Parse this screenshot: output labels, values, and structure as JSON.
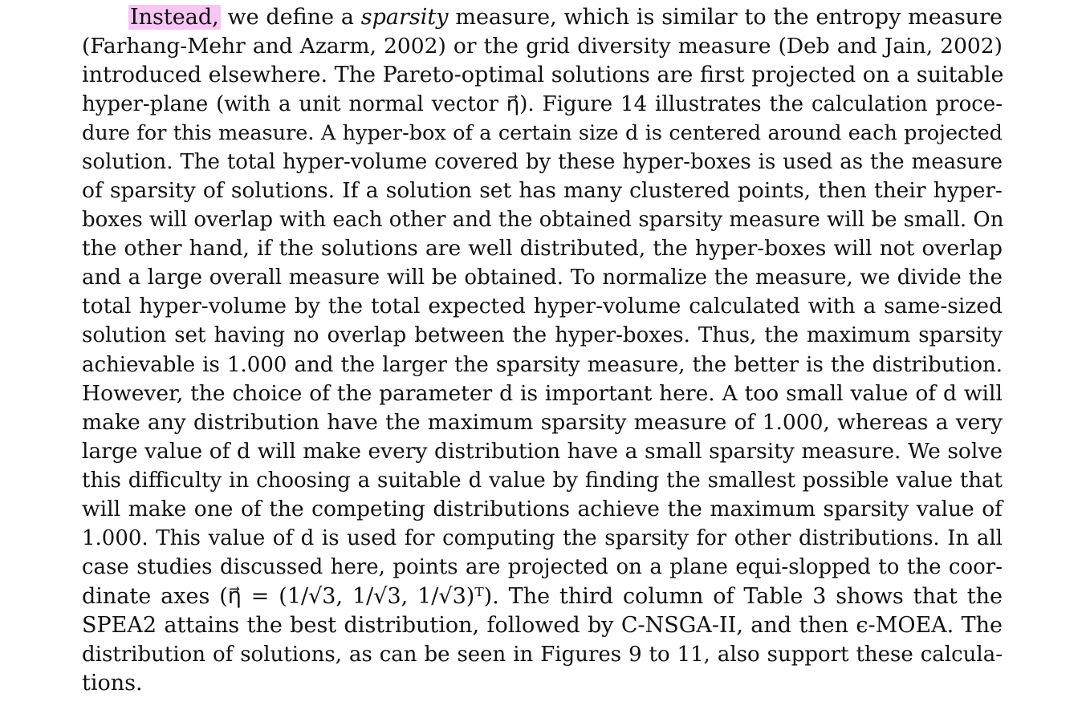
{
  "paragraph": {
    "highlight_word": "Instead,",
    "line0_a": "we define a",
    "line0_italic": "sparsity",
    "line0_b": "measure, which is similar to the entropy measure",
    "lines": [
      "(Farhang-Mehr and Azarm, 2002) or the grid diversity measure (Deb and Jain, 2002)",
      "introduced elsewhere.  The Pareto-optimal solutions are first projected on a suitable",
      "hyper-plane (with a unit normal vector η⃗). Figure 14 illustrates the calculation proce-",
      "dure for this measure. A hyper-box of a certain size d is centered around each projected",
      "solution. The total hyper-volume covered by these hyper-boxes is used as the measure",
      "of sparsity of solutions.  If a solution set has many clustered points, then their hyper-",
      "boxes will overlap with each other and the obtained sparsity measure will be small. On",
      "the other hand, if the solutions are well distributed, the hyper-boxes will not overlap",
      "and a large overall measure will be obtained. To normalize the measure, we divide the",
      "total hyper-volume by the total expected hyper-volume calculated with a same-sized",
      "solution set having no overlap between the hyper-boxes. Thus, the maximum sparsity",
      "achievable is 1.000 and the larger the sparsity measure, the better is the distribution.",
      "However, the choice of the parameter d is important here.  A too small value of d will",
      "make any distribution have the maximum sparsity measure of 1.000, whereas a very",
      "large value of d will make every distribution have a small sparsity measure. We solve",
      "this difficulty in choosing a suitable d value by finding the smallest possible value that",
      "will make one of the competing distributions achieve the maximum sparsity value of",
      "1.000. This value of d is used for computing the sparsity for other distributions. In all",
      "case studies discussed here, points are projected on a plane equi-slopped to the coor-",
      "dinate axes (η⃗ = (1/√3, 1/√3, 1/√3)ᵀ).  The third column of Table 3 shows that the",
      "SPEA2 attains the best distribution, followed by C-NSGA-II, and then ϵ-MOEA.  The",
      "distribution of solutions, as can be seen in Figures 9 to 11, also support these calcula-",
      "tions."
    ]
  }
}
